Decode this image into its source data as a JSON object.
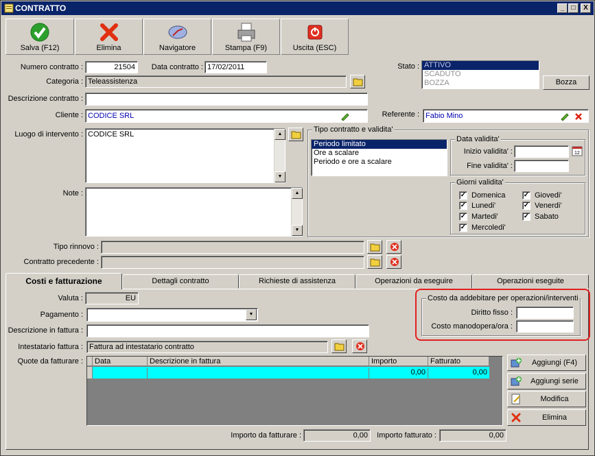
{
  "window": {
    "title": "CONTRATTO",
    "min": "_",
    "max": "□",
    "close": "X"
  },
  "toolbar": {
    "save": "Salva (F12)",
    "delete": "Elimina",
    "navigator": "Navigatore",
    "print": "Stampa (F9)",
    "exit": "Uscita (ESC)"
  },
  "form": {
    "numero_label": "Numero contratto :",
    "numero_value": "21504",
    "data_label": "Data contratto :",
    "data_value": "17/02/2011",
    "stato_label": "Stato :",
    "stato_options": [
      "ATTIVO",
      "SCADUTO",
      "BOZZA"
    ],
    "bozza_button": "Bozza",
    "categoria_label": "Categoria :",
    "categoria_value": "Teleassistenza",
    "descrizione_label": "Descrizione contratto :",
    "descrizione_value": "",
    "cliente_label": "Cliente :",
    "cliente_value": "CODICE SRL",
    "referente_label": "Referente :",
    "referente_value": "Fabio Mino",
    "luogo_label": "Luogo di intervento :",
    "luogo_value": "CODICE SRL",
    "note_label": "Note :",
    "note_value": "",
    "tipo_rinnovo_label": "Tipo rinnovo :",
    "tipo_rinnovo_value": "",
    "contratto_prec_label": "Contratto precedente :",
    "contratto_prec_value": ""
  },
  "tipo_contratto": {
    "title": "Tipo contratto e validita'",
    "options": [
      "Periodo limitato",
      "Ore a scalare",
      "Periodo e ore a scalare"
    ],
    "data_validita_title": "Data validita'",
    "inizio_label": "Inizio validita' :",
    "inizio_value": "",
    "fine_label": "Fine validita' :",
    "fine_value": "",
    "giorni_title": "Giorni validita'",
    "giorni": [
      {
        "label": "Domenica",
        "checked": true
      },
      {
        "label": "Giovedi'",
        "checked": true
      },
      {
        "label": "Lunedi'",
        "checked": true
      },
      {
        "label": "Venerdi'",
        "checked": true
      },
      {
        "label": "Martedi'",
        "checked": true
      },
      {
        "label": "Sabato",
        "checked": true
      },
      {
        "label": "Mercoledi'",
        "checked": true
      }
    ],
    "check_mark": "✓"
  },
  "tabs": [
    "Costi e fatturazione",
    "Dettagli contratto",
    "Richieste di assistenza",
    "Operazioni da eseguire",
    "Operazioni eseguite"
  ],
  "costi": {
    "valuta_label": "Valuta :",
    "valuta_value": "EU",
    "pagamento_label": "Pagamento :",
    "pagamento_value": "",
    "desc_fattura_label": "Descrizione in fattura :",
    "desc_fattura_value": "",
    "intestatario_label": "Intestatario fattura :",
    "intestatario_value": "Fattura ad intestatario contratto",
    "quote_label": "Quote da fatturare :",
    "grid_headers": [
      "Data",
      "Descrizione in fattura",
      "Importo",
      "Fatturato"
    ],
    "grid_row": {
      "data": "",
      "descrizione": "",
      "importo": "0,00",
      "fatturato": "0,00"
    },
    "addebito_title": "Costo da addebitare per operazioni/interventi",
    "diritto_label": "Diritto fisso :",
    "diritto_value": "",
    "manodopera_label": "Costo manodopera/ora :",
    "manodopera_value": "",
    "aggiungi_btn": "Aggiungi (F4)",
    "aggiungi_serie_btn": "Aggiungi serie",
    "modifica_btn": "Modifica",
    "elimina_btn": "Elimina",
    "importo_da_label": "Importo da fatturare :",
    "importo_da_value": "0,00",
    "importo_fatt_label": "Importo fatturato :",
    "importo_fatt_value": "0,00"
  },
  "colors": {
    "titlebar": "#0a246a",
    "grid_row": "#00ffff",
    "highlight": "#e02020",
    "face": "#d4d0c8"
  }
}
